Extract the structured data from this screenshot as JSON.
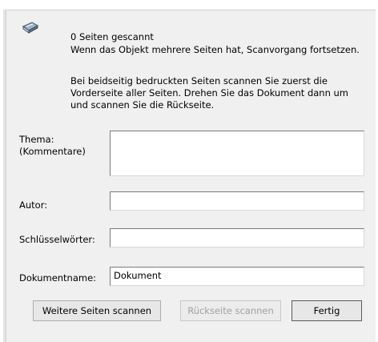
{
  "icons": {
    "scanner": "scanner-icon"
  },
  "messages": {
    "count": "0 Seiten gescannt",
    "multi_page": "Wenn das Objekt mehrere Seiten hat, Scanvorgang fortsetzen.",
    "duplex": "Bei beidseitig bedruckten Seiten scannen Sie zuerst die Vorderseite aller Seiten. Drehen Sie das Dokument dann um und scannen Sie die Rückseite."
  },
  "fields": {
    "subject_label_line1": "Thema:",
    "subject_label_line2": "(Kommentare)",
    "subject_value": "",
    "author_label": "Autor:",
    "author_value": "",
    "keywords_label": "Schlüsselwörter:",
    "keywords_value": "",
    "docname_label": "Dokumentname:",
    "docname_value": "Dokument"
  },
  "buttons": {
    "scan_more": "Weitere Seiten scannen",
    "scan_back": "Rückseite scannen",
    "done": "Fertig"
  },
  "colors": {
    "dialog_bg": "#f0f0f0",
    "field_bg": "#ffffff",
    "disabled_text": "#a0a0a0"
  }
}
